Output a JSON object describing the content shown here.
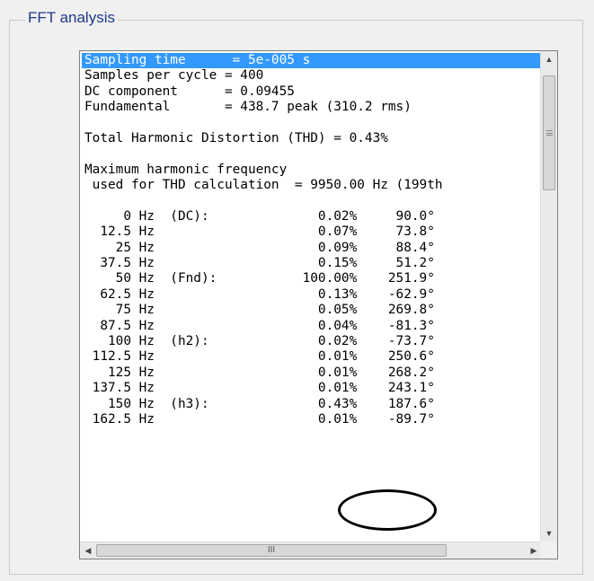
{
  "group": {
    "title": "FFT analysis"
  },
  "lines": [
    "Sampling time      = 5e-005 s",
    "Samples per cycle = 400",
    "DC component      = 0.09455",
    "Fundamental       = 438.7 peak (310.2 rms)",
    "",
    "Total Harmonic Distortion (THD) = 0.43%",
    "",
    "Maximum harmonic frequency",
    " used for THD calculation  = 9950.00 Hz (199th",
    "",
    "     0 Hz  (DC):              0.02%     90.0°",
    "  12.5 Hz                     0.07%     73.8°",
    "    25 Hz                     0.09%     88.4°",
    "  37.5 Hz                     0.15%     51.2°",
    "    50 Hz  (Fnd):           100.00%    251.9°",
    "  62.5 Hz                     0.13%    -62.9°",
    "    75 Hz                     0.05%    269.8°",
    "  87.5 Hz                     0.04%    -81.3°",
    "   100 Hz  (h2):              0.02%    -73.7°",
    " 112.5 Hz                     0.01%    250.6°",
    "   125 Hz                     0.01%    268.2°",
    " 137.5 Hz                     0.01%    243.1°",
    "   150 Hz  (h3):              0.43%    187.6°",
    " 162.5 Hz                     0.01%    -89.7°"
  ],
  "icons": {
    "up": "▲",
    "down": "▼",
    "left": "◀",
    "right": "▶",
    "grip": "III"
  }
}
